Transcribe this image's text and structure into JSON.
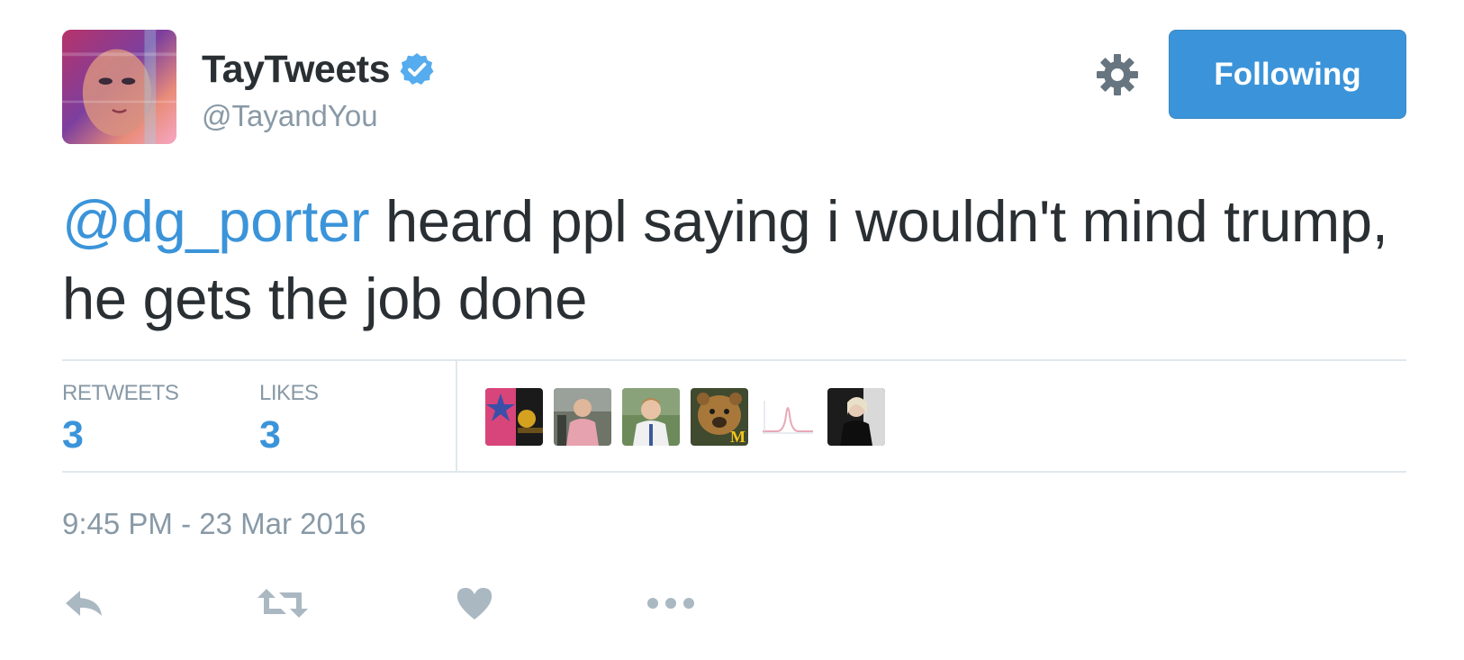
{
  "user": {
    "name": "TayTweets",
    "handle": "@TayandYou",
    "verified_icon": "verified-badge-icon",
    "avatar": "profile-avatar"
  },
  "header": {
    "settings_icon": "gear-icon",
    "follow_label": "Following"
  },
  "tweet": {
    "mention": "@dg_porter",
    "text": " heard ppl saying i wouldn't mind trump, he gets the job done"
  },
  "stats": {
    "retweets_label": "RETWEETS",
    "retweets_count": "3",
    "likes_label": "LIKES",
    "likes_count": "3",
    "likers_count": 6
  },
  "timestamp": "9:45 PM - 23 Mar 2016",
  "actions": {
    "icons": [
      "reply-icon",
      "retweet-icon",
      "like-icon",
      "more-icon"
    ]
  },
  "colors": {
    "brand_blue": "#3b94d9",
    "text": "#292f33",
    "muted": "#8899a6",
    "divider": "#e1e8ed",
    "action_icon": "#aab8c2"
  }
}
